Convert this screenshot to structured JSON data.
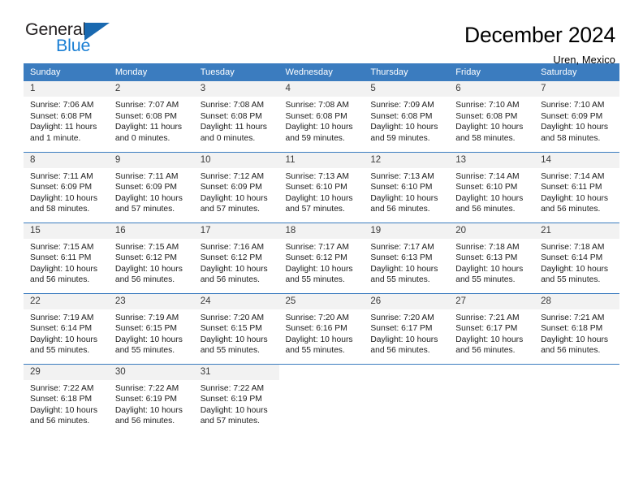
{
  "brand": {
    "name_part1": "General",
    "name_part2": "Blue",
    "accent_color": "#1a7fd4",
    "triangle_color": "#1a69b0",
    "triangle_icon": "triangle-icon"
  },
  "header": {
    "title": "December 2024",
    "subtitle": "Uren, Mexico"
  },
  "calendar": {
    "header_bg": "#3b7cbf",
    "daynum_bg": "#f2f2f2",
    "weekdays": [
      "Sunday",
      "Monday",
      "Tuesday",
      "Wednesday",
      "Thursday",
      "Friday",
      "Saturday"
    ],
    "weeks": [
      [
        {
          "day": "1",
          "sunrise": "Sunrise: 7:06 AM",
          "sunset": "Sunset: 6:08 PM",
          "daylight_line1": "Daylight: 11 hours",
          "daylight_line2": "and 1 minute."
        },
        {
          "day": "2",
          "sunrise": "Sunrise: 7:07 AM",
          "sunset": "Sunset: 6:08 PM",
          "daylight_line1": "Daylight: 11 hours",
          "daylight_line2": "and 0 minutes."
        },
        {
          "day": "3",
          "sunrise": "Sunrise: 7:08 AM",
          "sunset": "Sunset: 6:08 PM",
          "daylight_line1": "Daylight: 11 hours",
          "daylight_line2": "and 0 minutes."
        },
        {
          "day": "4",
          "sunrise": "Sunrise: 7:08 AM",
          "sunset": "Sunset: 6:08 PM",
          "daylight_line1": "Daylight: 10 hours",
          "daylight_line2": "and 59 minutes."
        },
        {
          "day": "5",
          "sunrise": "Sunrise: 7:09 AM",
          "sunset": "Sunset: 6:08 PM",
          "daylight_line1": "Daylight: 10 hours",
          "daylight_line2": "and 59 minutes."
        },
        {
          "day": "6",
          "sunrise": "Sunrise: 7:10 AM",
          "sunset": "Sunset: 6:08 PM",
          "daylight_line1": "Daylight: 10 hours",
          "daylight_line2": "and 58 minutes."
        },
        {
          "day": "7",
          "sunrise": "Sunrise: 7:10 AM",
          "sunset": "Sunset: 6:09 PM",
          "daylight_line1": "Daylight: 10 hours",
          "daylight_line2": "and 58 minutes."
        }
      ],
      [
        {
          "day": "8",
          "sunrise": "Sunrise: 7:11 AM",
          "sunset": "Sunset: 6:09 PM",
          "daylight_line1": "Daylight: 10 hours",
          "daylight_line2": "and 58 minutes."
        },
        {
          "day": "9",
          "sunrise": "Sunrise: 7:11 AM",
          "sunset": "Sunset: 6:09 PM",
          "daylight_line1": "Daylight: 10 hours",
          "daylight_line2": "and 57 minutes."
        },
        {
          "day": "10",
          "sunrise": "Sunrise: 7:12 AM",
          "sunset": "Sunset: 6:09 PM",
          "daylight_line1": "Daylight: 10 hours",
          "daylight_line2": "and 57 minutes."
        },
        {
          "day": "11",
          "sunrise": "Sunrise: 7:13 AM",
          "sunset": "Sunset: 6:10 PM",
          "daylight_line1": "Daylight: 10 hours",
          "daylight_line2": "and 57 minutes."
        },
        {
          "day": "12",
          "sunrise": "Sunrise: 7:13 AM",
          "sunset": "Sunset: 6:10 PM",
          "daylight_line1": "Daylight: 10 hours",
          "daylight_line2": "and 56 minutes."
        },
        {
          "day": "13",
          "sunrise": "Sunrise: 7:14 AM",
          "sunset": "Sunset: 6:10 PM",
          "daylight_line1": "Daylight: 10 hours",
          "daylight_line2": "and 56 minutes."
        },
        {
          "day": "14",
          "sunrise": "Sunrise: 7:14 AM",
          "sunset": "Sunset: 6:11 PM",
          "daylight_line1": "Daylight: 10 hours",
          "daylight_line2": "and 56 minutes."
        }
      ],
      [
        {
          "day": "15",
          "sunrise": "Sunrise: 7:15 AM",
          "sunset": "Sunset: 6:11 PM",
          "daylight_line1": "Daylight: 10 hours",
          "daylight_line2": "and 56 minutes."
        },
        {
          "day": "16",
          "sunrise": "Sunrise: 7:15 AM",
          "sunset": "Sunset: 6:12 PM",
          "daylight_line1": "Daylight: 10 hours",
          "daylight_line2": "and 56 minutes."
        },
        {
          "day": "17",
          "sunrise": "Sunrise: 7:16 AM",
          "sunset": "Sunset: 6:12 PM",
          "daylight_line1": "Daylight: 10 hours",
          "daylight_line2": "and 56 minutes."
        },
        {
          "day": "18",
          "sunrise": "Sunrise: 7:17 AM",
          "sunset": "Sunset: 6:12 PM",
          "daylight_line1": "Daylight: 10 hours",
          "daylight_line2": "and 55 minutes."
        },
        {
          "day": "19",
          "sunrise": "Sunrise: 7:17 AM",
          "sunset": "Sunset: 6:13 PM",
          "daylight_line1": "Daylight: 10 hours",
          "daylight_line2": "and 55 minutes."
        },
        {
          "day": "20",
          "sunrise": "Sunrise: 7:18 AM",
          "sunset": "Sunset: 6:13 PM",
          "daylight_line1": "Daylight: 10 hours",
          "daylight_line2": "and 55 minutes."
        },
        {
          "day": "21",
          "sunrise": "Sunrise: 7:18 AM",
          "sunset": "Sunset: 6:14 PM",
          "daylight_line1": "Daylight: 10 hours",
          "daylight_line2": "and 55 minutes."
        }
      ],
      [
        {
          "day": "22",
          "sunrise": "Sunrise: 7:19 AM",
          "sunset": "Sunset: 6:14 PM",
          "daylight_line1": "Daylight: 10 hours",
          "daylight_line2": "and 55 minutes."
        },
        {
          "day": "23",
          "sunrise": "Sunrise: 7:19 AM",
          "sunset": "Sunset: 6:15 PM",
          "daylight_line1": "Daylight: 10 hours",
          "daylight_line2": "and 55 minutes."
        },
        {
          "day": "24",
          "sunrise": "Sunrise: 7:20 AM",
          "sunset": "Sunset: 6:15 PM",
          "daylight_line1": "Daylight: 10 hours",
          "daylight_line2": "and 55 minutes."
        },
        {
          "day": "25",
          "sunrise": "Sunrise: 7:20 AM",
          "sunset": "Sunset: 6:16 PM",
          "daylight_line1": "Daylight: 10 hours",
          "daylight_line2": "and 55 minutes."
        },
        {
          "day": "26",
          "sunrise": "Sunrise: 7:20 AM",
          "sunset": "Sunset: 6:17 PM",
          "daylight_line1": "Daylight: 10 hours",
          "daylight_line2": "and 56 minutes."
        },
        {
          "day": "27",
          "sunrise": "Sunrise: 7:21 AM",
          "sunset": "Sunset: 6:17 PM",
          "daylight_line1": "Daylight: 10 hours",
          "daylight_line2": "and 56 minutes."
        },
        {
          "day": "28",
          "sunrise": "Sunrise: 7:21 AM",
          "sunset": "Sunset: 6:18 PM",
          "daylight_line1": "Daylight: 10 hours",
          "daylight_line2": "and 56 minutes."
        }
      ],
      [
        {
          "day": "29",
          "sunrise": "Sunrise: 7:22 AM",
          "sunset": "Sunset: 6:18 PM",
          "daylight_line1": "Daylight: 10 hours",
          "daylight_line2": "and 56 minutes."
        },
        {
          "day": "30",
          "sunrise": "Sunrise: 7:22 AM",
          "sunset": "Sunset: 6:19 PM",
          "daylight_line1": "Daylight: 10 hours",
          "daylight_line2": "and 56 minutes."
        },
        {
          "day": "31",
          "sunrise": "Sunrise: 7:22 AM",
          "sunset": "Sunset: 6:19 PM",
          "daylight_line1": "Daylight: 10 hours",
          "daylight_line2": "and 57 minutes."
        },
        {
          "day": "",
          "sunrise": "",
          "sunset": "",
          "daylight_line1": "",
          "daylight_line2": ""
        },
        {
          "day": "",
          "sunrise": "",
          "sunset": "",
          "daylight_line1": "",
          "daylight_line2": ""
        },
        {
          "day": "",
          "sunrise": "",
          "sunset": "",
          "daylight_line1": "",
          "daylight_line2": ""
        },
        {
          "day": "",
          "sunrise": "",
          "sunset": "",
          "daylight_line1": "",
          "daylight_line2": ""
        }
      ]
    ]
  }
}
